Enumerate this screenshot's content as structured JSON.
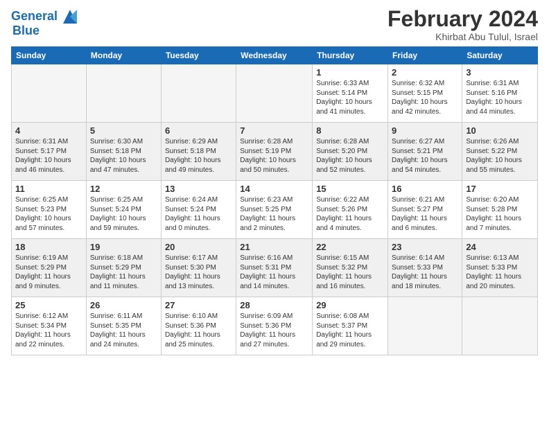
{
  "header": {
    "logo_line1": "General",
    "logo_line2": "Blue",
    "title": "February 2024",
    "subtitle": "Khirbat Abu Tulul, Israel"
  },
  "days_of_week": [
    "Sunday",
    "Monday",
    "Tuesday",
    "Wednesday",
    "Thursday",
    "Friday",
    "Saturday"
  ],
  "weeks": [
    [
      {
        "num": "",
        "info": ""
      },
      {
        "num": "",
        "info": ""
      },
      {
        "num": "",
        "info": ""
      },
      {
        "num": "",
        "info": ""
      },
      {
        "num": "1",
        "info": "Sunrise: 6:33 AM\nSunset: 5:14 PM\nDaylight: 10 hours\nand 41 minutes."
      },
      {
        "num": "2",
        "info": "Sunrise: 6:32 AM\nSunset: 5:15 PM\nDaylight: 10 hours\nand 42 minutes."
      },
      {
        "num": "3",
        "info": "Sunrise: 6:31 AM\nSunset: 5:16 PM\nDaylight: 10 hours\nand 44 minutes."
      }
    ],
    [
      {
        "num": "4",
        "info": "Sunrise: 6:31 AM\nSunset: 5:17 PM\nDaylight: 10 hours\nand 46 minutes."
      },
      {
        "num": "5",
        "info": "Sunrise: 6:30 AM\nSunset: 5:18 PM\nDaylight: 10 hours\nand 47 minutes."
      },
      {
        "num": "6",
        "info": "Sunrise: 6:29 AM\nSunset: 5:18 PM\nDaylight: 10 hours\nand 49 minutes."
      },
      {
        "num": "7",
        "info": "Sunrise: 6:28 AM\nSunset: 5:19 PM\nDaylight: 10 hours\nand 50 minutes."
      },
      {
        "num": "8",
        "info": "Sunrise: 6:28 AM\nSunset: 5:20 PM\nDaylight: 10 hours\nand 52 minutes."
      },
      {
        "num": "9",
        "info": "Sunrise: 6:27 AM\nSunset: 5:21 PM\nDaylight: 10 hours\nand 54 minutes."
      },
      {
        "num": "10",
        "info": "Sunrise: 6:26 AM\nSunset: 5:22 PM\nDaylight: 10 hours\nand 55 minutes."
      }
    ],
    [
      {
        "num": "11",
        "info": "Sunrise: 6:25 AM\nSunset: 5:23 PM\nDaylight: 10 hours\nand 57 minutes."
      },
      {
        "num": "12",
        "info": "Sunrise: 6:25 AM\nSunset: 5:24 PM\nDaylight: 10 hours\nand 59 minutes."
      },
      {
        "num": "13",
        "info": "Sunrise: 6:24 AM\nSunset: 5:24 PM\nDaylight: 11 hours\nand 0 minutes."
      },
      {
        "num": "14",
        "info": "Sunrise: 6:23 AM\nSunset: 5:25 PM\nDaylight: 11 hours\nand 2 minutes."
      },
      {
        "num": "15",
        "info": "Sunrise: 6:22 AM\nSunset: 5:26 PM\nDaylight: 11 hours\nand 4 minutes."
      },
      {
        "num": "16",
        "info": "Sunrise: 6:21 AM\nSunset: 5:27 PM\nDaylight: 11 hours\nand 6 minutes."
      },
      {
        "num": "17",
        "info": "Sunrise: 6:20 AM\nSunset: 5:28 PM\nDaylight: 11 hours\nand 7 minutes."
      }
    ],
    [
      {
        "num": "18",
        "info": "Sunrise: 6:19 AM\nSunset: 5:29 PM\nDaylight: 11 hours\nand 9 minutes."
      },
      {
        "num": "19",
        "info": "Sunrise: 6:18 AM\nSunset: 5:29 PM\nDaylight: 11 hours\nand 11 minutes."
      },
      {
        "num": "20",
        "info": "Sunrise: 6:17 AM\nSunset: 5:30 PM\nDaylight: 11 hours\nand 13 minutes."
      },
      {
        "num": "21",
        "info": "Sunrise: 6:16 AM\nSunset: 5:31 PM\nDaylight: 11 hours\nand 14 minutes."
      },
      {
        "num": "22",
        "info": "Sunrise: 6:15 AM\nSunset: 5:32 PM\nDaylight: 11 hours\nand 16 minutes."
      },
      {
        "num": "23",
        "info": "Sunrise: 6:14 AM\nSunset: 5:33 PM\nDaylight: 11 hours\nand 18 minutes."
      },
      {
        "num": "24",
        "info": "Sunrise: 6:13 AM\nSunset: 5:33 PM\nDaylight: 11 hours\nand 20 minutes."
      }
    ],
    [
      {
        "num": "25",
        "info": "Sunrise: 6:12 AM\nSunset: 5:34 PM\nDaylight: 11 hours\nand 22 minutes."
      },
      {
        "num": "26",
        "info": "Sunrise: 6:11 AM\nSunset: 5:35 PM\nDaylight: 11 hours\nand 24 minutes."
      },
      {
        "num": "27",
        "info": "Sunrise: 6:10 AM\nSunset: 5:36 PM\nDaylight: 11 hours\nand 25 minutes."
      },
      {
        "num": "28",
        "info": "Sunrise: 6:09 AM\nSunset: 5:36 PM\nDaylight: 11 hours\nand 27 minutes."
      },
      {
        "num": "29",
        "info": "Sunrise: 6:08 AM\nSunset: 5:37 PM\nDaylight: 11 hours\nand 29 minutes."
      },
      {
        "num": "",
        "info": ""
      },
      {
        "num": "",
        "info": ""
      }
    ]
  ]
}
